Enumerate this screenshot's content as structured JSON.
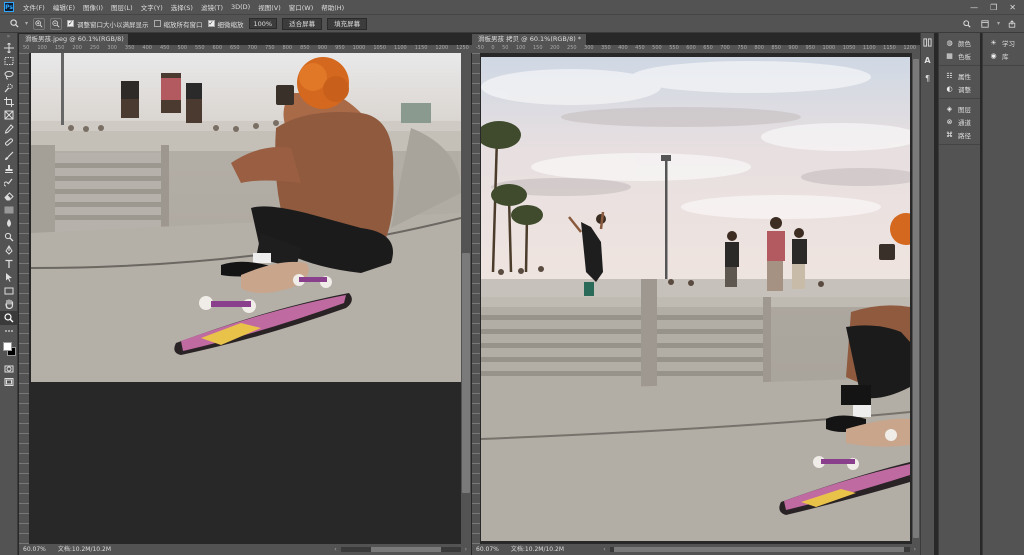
{
  "menubar": {
    "logo": "Ps",
    "items": [
      "文件(F)",
      "编辑(E)",
      "图像(I)",
      "图层(L)",
      "文字(Y)",
      "选择(S)",
      "滤镜(T)",
      "3D(D)",
      "视图(V)",
      "窗口(W)",
      "帮助(H)"
    ],
    "window_controls": [
      "—",
      "❐",
      "✕"
    ]
  },
  "options": {
    "resize_windows": "调整窗口大小以满屏显示",
    "zoom_all_windows": "缩放所有窗口",
    "scrubby_zoom": "细微缩放",
    "zoom_value": "100%",
    "fit_screen": "适合屏幕",
    "fill_screen": "填充屏幕"
  },
  "doc1": {
    "tab": "滑板男孩.jpeg @ 60.1%(RGB/8)",
    "zoom": "60.07%",
    "doc_size": "文档:10.2M/10.2M",
    "ruler": [
      "50",
      "100",
      "150",
      "200",
      "250",
      "300",
      "350",
      "400",
      "450",
      "500",
      "550",
      "600",
      "650",
      "700",
      "750",
      "800",
      "850",
      "900",
      "950",
      "1000",
      "1050",
      "1100",
      "1150",
      "1200",
      "1250"
    ]
  },
  "doc2": {
    "tab": "滑板男孩 拷贝 @ 60.1%(RGB/8) *",
    "zoom": "60.07%",
    "doc_size": "文档:10.2M/10.2M",
    "ruler": [
      "-50",
      "0",
      "50",
      "100",
      "150",
      "200",
      "250",
      "300",
      "350",
      "400",
      "450",
      "500",
      "550",
      "600",
      "650",
      "700",
      "750",
      "800",
      "850",
      "900",
      "950",
      "1000",
      "1050",
      "1100",
      "1150",
      "1200"
    ]
  },
  "panels": {
    "group1": [
      "颜色",
      "色板"
    ],
    "group2": [
      "属性",
      "调整"
    ],
    "group3": [
      "图层",
      "通道",
      "路径"
    ],
    "group4": [
      "学习",
      "库"
    ]
  }
}
